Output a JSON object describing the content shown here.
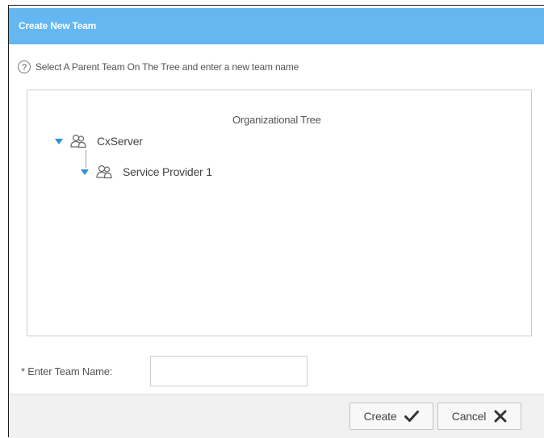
{
  "dialog": {
    "title": "Create New Team",
    "hint": "Select A Parent Team On The Tree and enter a new team name",
    "help_icon": "question-circle-icon"
  },
  "tree": {
    "caption": "Organizational Tree",
    "nodes": [
      {
        "label": "CxServer",
        "expanded": true,
        "icon": "team-icon"
      },
      {
        "label": "Service Provider 1",
        "expanded": true,
        "icon": "team-icon"
      }
    ],
    "accent_color": "#2e8fd6"
  },
  "form": {
    "team_name_label": "* Enter Team Name:",
    "team_name_value": "",
    "team_name_placeholder": ""
  },
  "buttons": {
    "create_label": "Create",
    "create_icon": "checkmark-icon",
    "cancel_label": "Cancel",
    "cancel_icon": "close-icon"
  },
  "colors": {
    "titlebar": "#64b7f0",
    "footer": "#f1f1f1"
  }
}
